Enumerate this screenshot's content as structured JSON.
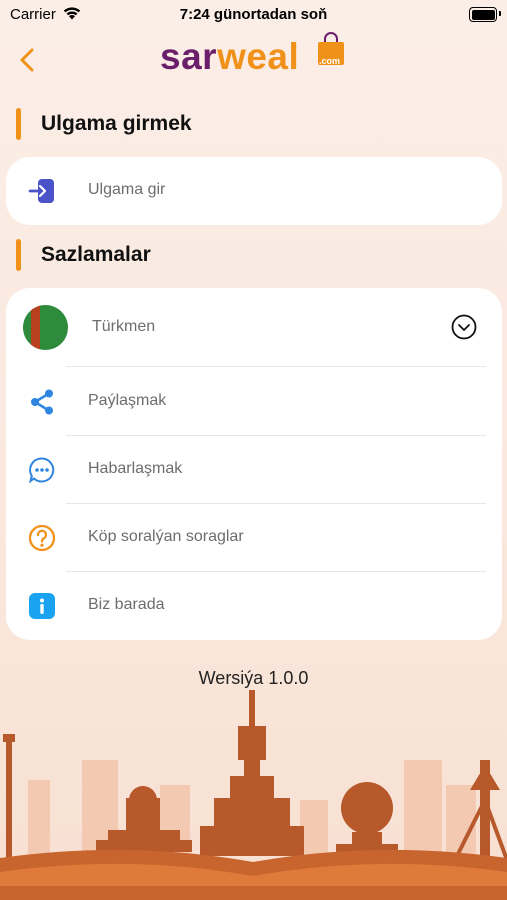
{
  "status_bar": {
    "carrier": "Carrier",
    "time": "7:24 günortadan soň"
  },
  "header": {
    "logo_part1": "sar",
    "logo_part2": "weal",
    "logo_domain": ".com"
  },
  "login_section": {
    "title": "Ulgama girmek",
    "login_label": "Ulgama gir"
  },
  "settings_section": {
    "title": "Sazlamalar",
    "items": [
      {
        "label": "Türkmen",
        "icon": "turkmenistan-flag-icon"
      },
      {
        "label": "Paýlaşmak",
        "icon": "share-icon"
      },
      {
        "label": "Habarlaşmak",
        "icon": "chat-bubble-icon"
      },
      {
        "label": "Köp soralýan soraglar",
        "icon": "question-icon"
      },
      {
        "label": "Biz barada",
        "icon": "info-icon"
      }
    ]
  },
  "footer": {
    "version": "Wersiýa 1.0.0"
  },
  "colors": {
    "accent": "#f0921a",
    "brand_purple": "#6b1f6a",
    "share_blue": "#2f86e0",
    "info_blue": "#19a3f0",
    "login_indigo": "#4b53c8",
    "skyline": "#b8592c"
  }
}
